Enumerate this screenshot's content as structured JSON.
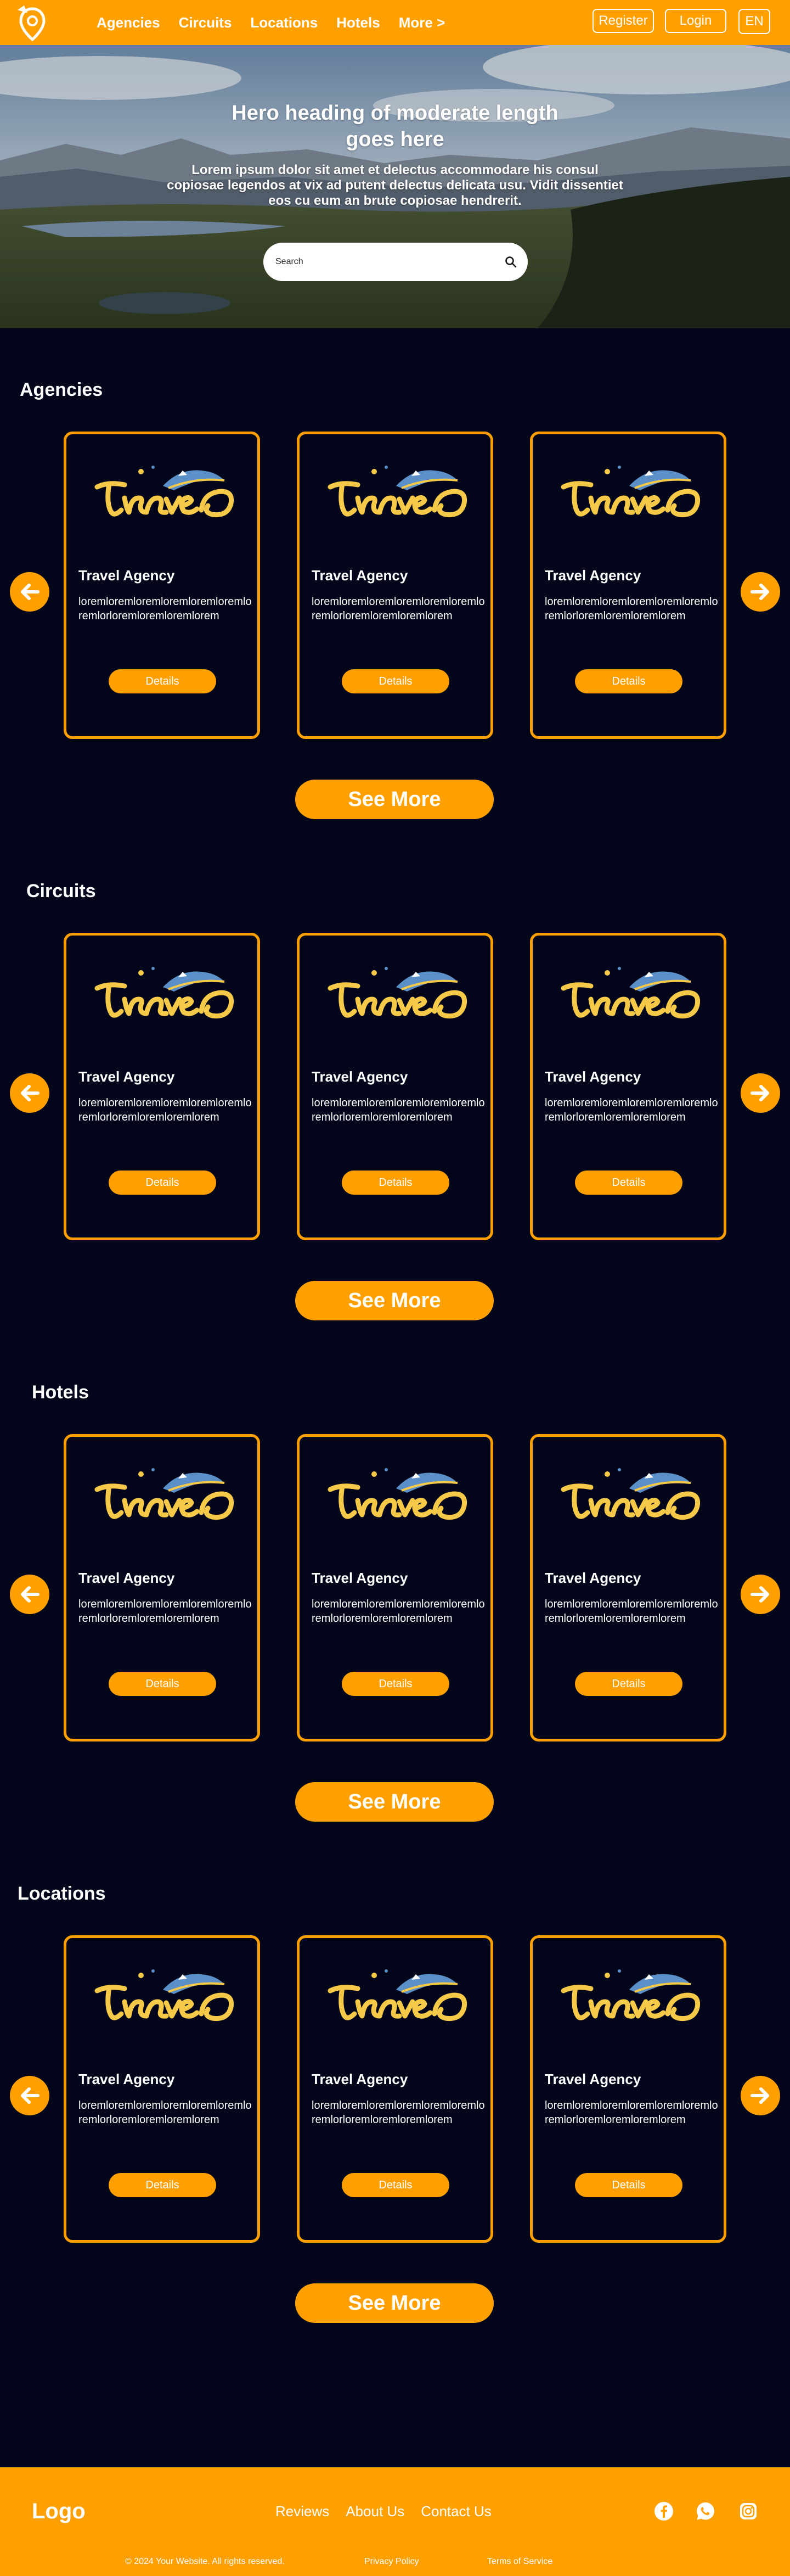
{
  "colors": {
    "accent": "#ffa000",
    "background": "#03061a",
    "text": "#ffffff"
  },
  "navbar": {
    "logo_icon": "location-pin-plane-logo-icon",
    "links": [
      "Agencies",
      "Circuits",
      "Locations",
      "Hotels",
      "More >"
    ],
    "register_label": "Register",
    "login_label": "Login",
    "language": "EN"
  },
  "hero": {
    "title": "Hero heading of moderate length goes here",
    "description": "Lorem ipsum dolor sit amet et delectus accommodare his consul copiosae legendos at vix ad putent delectus delicata usu. Vidit dissentiet eos cu eum an brute copiosae hendrerit.",
    "search_placeholder": "Search",
    "search_icon": "search-icon"
  },
  "card_template": {
    "logo_text": "travel",
    "title": "Travel Agency",
    "description": "loremloremloremloremloremloremloremlorloremloremloremlorem",
    "button_label": "Details"
  },
  "sections": [
    {
      "title": "Agencies",
      "cards": [
        {
          "title": "Travel Agency",
          "description": "loremloremloremloremloremloremloremlorloremloremloremlorem",
          "button": "Details"
        },
        {
          "title": "Travel Agency",
          "description": "loremloremloremloremloremloremloremlorloremloremloremlorem",
          "button": "Details"
        },
        {
          "title": "Travel Agency",
          "description": "loremloremloremloremloremloremloremlorloremloremloremlorem",
          "button": "Details"
        }
      ],
      "see_more": "See More"
    },
    {
      "title": "Circuits",
      "cards": [
        {
          "title": "Travel Agency",
          "description": "loremloremloremloremloremloremloremlorloremloremloremlorem",
          "button": "Details"
        },
        {
          "title": "Travel Agency",
          "description": "loremloremloremloremloremloremloremlorloremloremloremlorem",
          "button": "Details"
        },
        {
          "title": "Travel Agency",
          "description": "loremloremloremloremloremloremloremlorloremloremloremlorem",
          "button": "Details"
        }
      ],
      "see_more": "See More"
    },
    {
      "title": "Hotels",
      "cards": [
        {
          "title": "Travel Agency",
          "description": "loremloremloremloremloremloremloremlorloremloremloremlorem",
          "button": "Details"
        },
        {
          "title": "Travel Agency",
          "description": "loremloremloremloremloremloremloremlorloremloremloremlorem",
          "button": "Details"
        },
        {
          "title": "Travel Agency",
          "description": "loremloremloremloremloremloremloremlorloremloremloremlorem",
          "button": "Details"
        }
      ],
      "see_more": "See More"
    },
    {
      "title": "Locations",
      "cards": [
        {
          "title": "Travel Agency",
          "description": "loremloremloremloremloremloremloremlorloremloremloremlorem",
          "button": "Details"
        },
        {
          "title": "Travel Agency",
          "description": "loremloremloremloremloremloremloremlorloremloremloremlorem",
          "button": "Details"
        },
        {
          "title": "Travel Agency",
          "description": "loremloremloremloremloremloremloremlorloremloremloremlorem",
          "button": "Details"
        }
      ],
      "see_more": "See More"
    }
  ],
  "footer": {
    "logo": "Logo",
    "links": [
      "Reviews",
      "About Us",
      "Contact Us"
    ],
    "social_icons": [
      "facebook-icon",
      "whatsapp-icon",
      "instagram-icon"
    ],
    "copyright": "© 2024 Your Website. All rights reserved.",
    "privacy": "Privacy Policy",
    "terms": "Terms of Service"
  }
}
